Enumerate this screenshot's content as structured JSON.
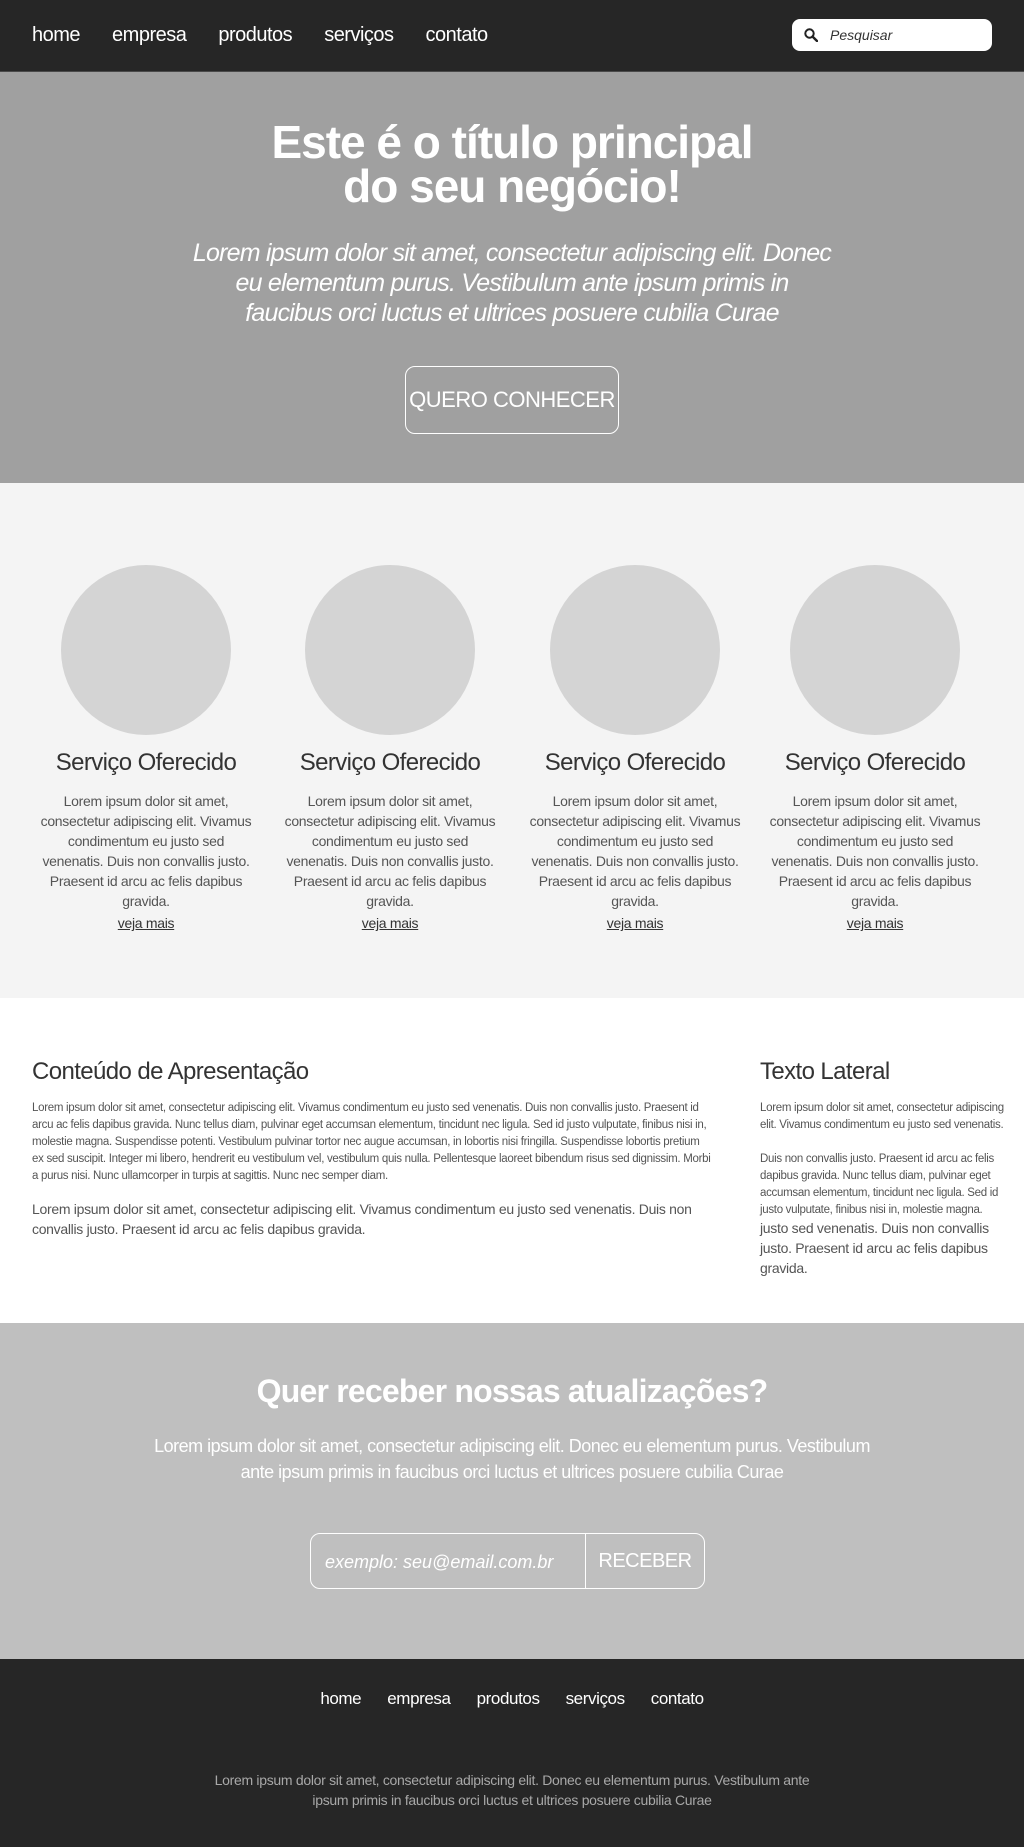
{
  "nav": {
    "items": [
      "home",
      "empresa",
      "produtos",
      "serviços",
      "contato"
    ],
    "search_placeholder": "Pesquisar",
    "search_icon": "search-icon"
  },
  "hero": {
    "title_line1": "Este é o título principal",
    "title_line2": "do seu negócio!",
    "subtitle": "Lorem ipsum dolor sit amet, consectetur adipiscing elit. Donec eu elementum purus. Vestibulum ante ipsum primis in faucibus orci luctus et ultrices posuere cubilia Curae",
    "cta_label": "QUERO CONHECER"
  },
  "services": [
    {
      "title": "Serviço Oferecido",
      "text": "Lorem ipsum dolor sit amet, consectetur adipiscing elit. Vivamus condimentum eu justo sed venenatis. Duis non convallis justo. Praesent id arcu ac felis dapibus gravida.",
      "link": "veja mais"
    },
    {
      "title": "Serviço Oferecido",
      "text": "Lorem ipsum dolor sit amet, consectetur adipiscing elit. Vivamus condimentum eu justo sed venenatis. Duis non convallis justo. Praesent id arcu ac felis dapibus gravida.",
      "link": "veja mais"
    },
    {
      "title": "Serviço Oferecido",
      "text": "Lorem ipsum dolor sit amet, consectetur adipiscing elit. Vivamus condimentum eu justo sed venenatis. Duis non convallis justo. Praesent id arcu ac felis dapibus gravida.",
      "link": "veja mais"
    },
    {
      "title": "Serviço Oferecido",
      "text": "Lorem ipsum dolor sit amet, consectetur adipiscing elit. Vivamus condimentum eu justo sed venenatis. Duis non convallis justo. Praesent id arcu ac felis dapibus gravida.",
      "link": "veja mais"
    }
  ],
  "content": {
    "main_title": "Conteúdo de Apresentação",
    "main_p1": "Lorem ipsum dolor sit amet, consectetur adipiscing elit. Vivamus condimentum eu justo sed venenatis. Duis non convallis justo. Praesent id arcu ac felis dapibus gravida. Nunc tellus diam, pulvinar eget accumsan elementum, tincidunt nec ligula. Sed id justo vulputate, finibus nisi in, molestie magna. Suspendisse potenti. Vestibulum pulvinar tortor nec augue accumsan, in lobortis nisi fringilla. Suspendisse lobortis pretium ex sed suscipit. Integer mi libero, hendrerit eu vestibulum vel, vestibulum quis nulla. Pellentesque laoreet bibendum risus sed dignissim. Morbi a purus nisi. Nunc ullamcorper in turpis at sagittis. Nunc nec semper diam.",
    "main_p2": "Lorem ipsum dolor sit amet, consectetur adipiscing elit. Vivamus condimentum eu justo sed venenatis. Duis non convallis justo. Praesent id arcu ac felis dapibus gravida.",
    "side_title": "Texto Lateral",
    "side_p1": "Lorem ipsum dolor sit amet, consectetur adipiscing elit. Vivamus condimentum eu justo sed venenatis.",
    "side_p2_small": "Duis non convallis justo. Praesent id arcu ac felis dapibus gravida. Nunc tellus diam, pulvinar eget accumsan elementum, tincidunt nec ligula. Sed id justo vulputate, finibus nisi in, molestie magna.",
    "side_p2_large": "justo sed venenatis. Duis non convallis justo. Praesent id arcu ac felis dapibus gravida."
  },
  "newsletter": {
    "title": "Quer receber nossas atualizações?",
    "text": "Lorem ipsum dolor sit amet, consectetur adipiscing elit. Donec eu elementum purus. Vestibulum ante ipsum primis in faucibus orci luctus et ultrices posuere cubilia Curae",
    "email_placeholder": "exemplo: seu@email.com.br",
    "submit_label": "RECEBER"
  },
  "footer": {
    "items": [
      "home",
      "empresa",
      "produtos",
      "serviços",
      "contato"
    ],
    "text": "Lorem ipsum dolor sit amet, consectetur adipiscing elit. Donec eu elementum purus. Vestibulum ante ipsum primis in faucibus orci luctus et ultrices posuere cubilia Curae"
  }
}
